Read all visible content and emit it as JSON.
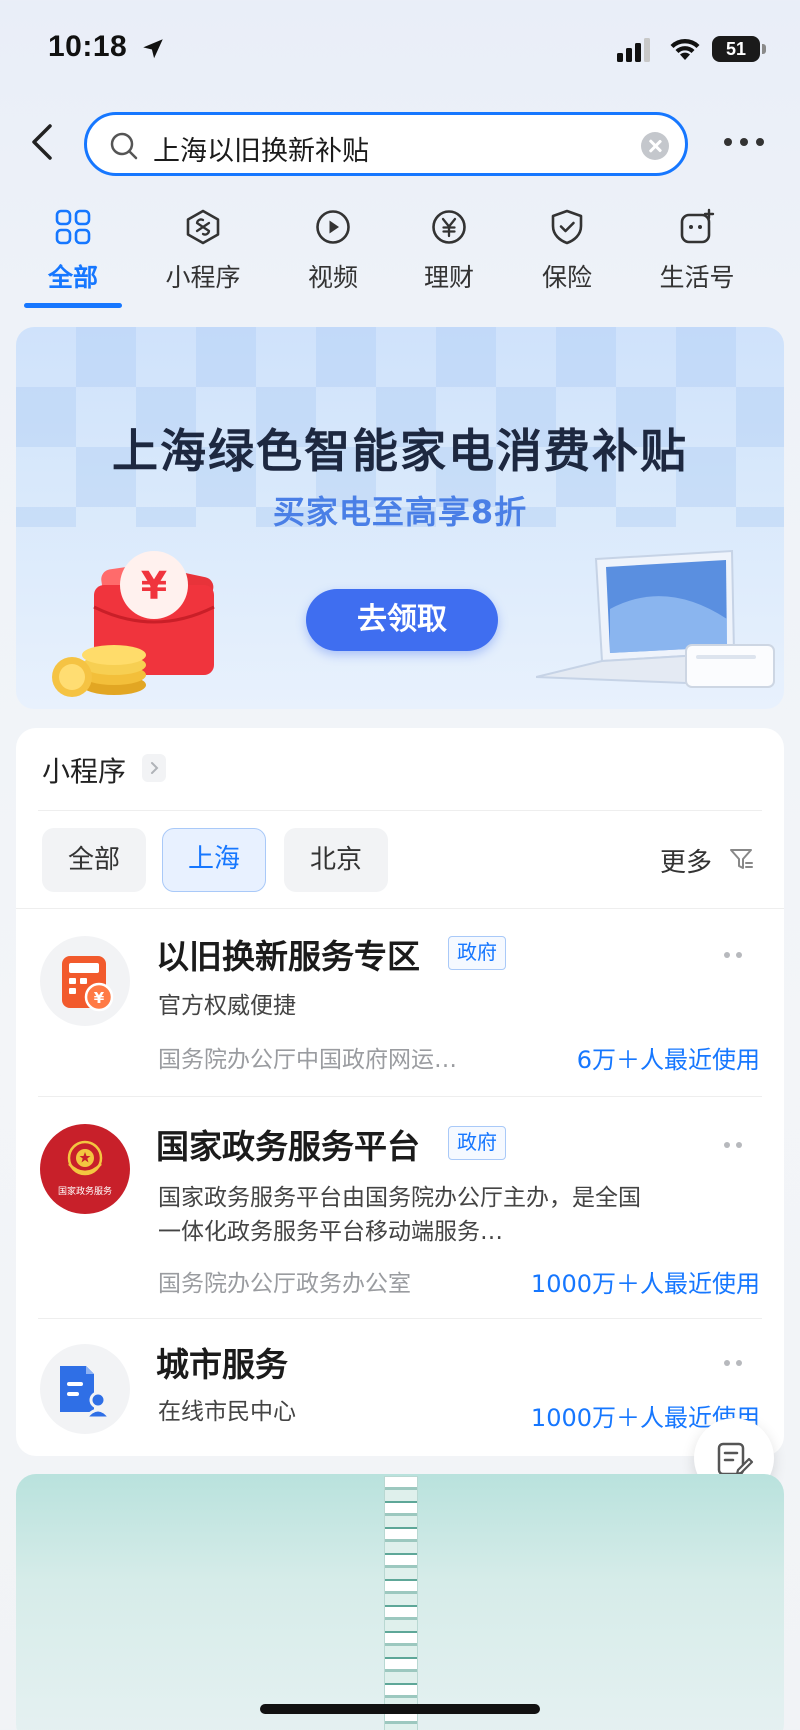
{
  "status_bar": {
    "time": "10:18",
    "battery": "51"
  },
  "search": {
    "query": "上海以旧换新补贴"
  },
  "tabs": [
    {
      "label": "全部",
      "icon": "grid-icon"
    },
    {
      "label": "小程序",
      "icon": "mini-program-icon"
    },
    {
      "label": "视频",
      "icon": "video-icon"
    },
    {
      "label": "理财",
      "icon": "yen-icon"
    },
    {
      "label": "保险",
      "icon": "shield-icon"
    },
    {
      "label": "生活号",
      "icon": "life-account-icon"
    }
  ],
  "banner": {
    "title": "上海绿色智能家电消费补贴",
    "subtitle": "买家电至高享8折",
    "button": "去领取"
  },
  "mini_programs": {
    "title": "小程序",
    "filters": [
      "全部",
      "上海",
      "北京"
    ],
    "active_filter": "上海",
    "more_label": "更多",
    "items": [
      {
        "name": "以旧换新服务专区",
        "tag": "政府",
        "desc": "官方权威便捷",
        "org": "国务院办公厅中国政府网运…",
        "usage": "6万＋人最近使用"
      },
      {
        "name": "国家政务服务平台",
        "tag": "政府",
        "desc_line1": "国家政务服务平台由国务院办公厅主办，是全国",
        "desc_line2": "一体化政务服务平台移动端服务…",
        "org": "国务院办公厅政务办公室",
        "usage": "1000万＋人最近使用",
        "logo_text": "国家政务服务"
      },
      {
        "name": "城市服务",
        "desc": "在线市民中心",
        "usage": "1000万＋人最近使用"
      }
    ]
  },
  "colors": {
    "accent": "#1677ff",
    "banner_button": "#3f6ef0",
    "emblem_red": "#c8202a"
  }
}
